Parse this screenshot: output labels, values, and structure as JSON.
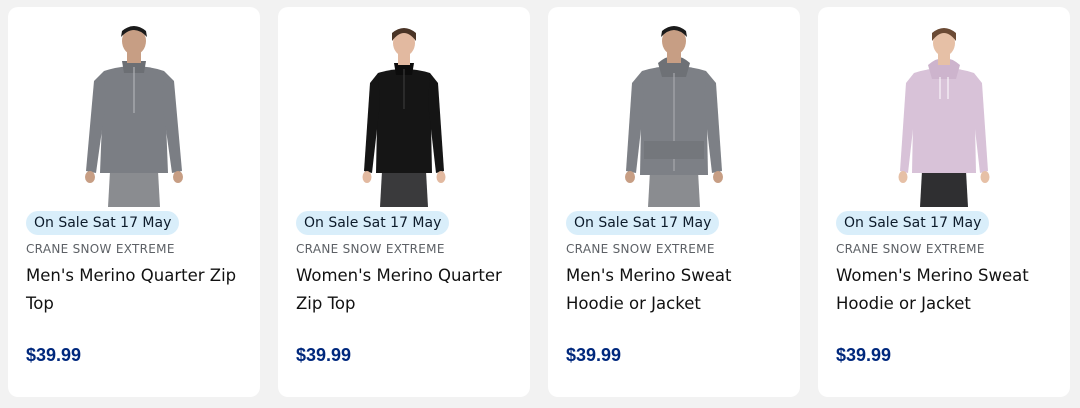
{
  "theme": {
    "badge_bg": "#d9eefa",
    "price_color": "#00287d",
    "card_bg": "#ffffff",
    "page_bg": "#f2f2f2"
  },
  "products": [
    {
      "image": "mens-grey-merino-quarter-zip-model",
      "badge": "On Sale Sat 17 May",
      "brand": "CRANE SNOW EXTREME",
      "title": "Men's Merino Quarter Zip Top",
      "price": "$39.99",
      "garment_color": "#7b7e84"
    },
    {
      "image": "womens-black-merino-quarter-zip-model",
      "badge": "On Sale Sat 17 May",
      "brand": "CRANE SNOW EXTREME",
      "title": "Women's Merino Quarter Zip Top",
      "price": "$39.99",
      "garment_color": "#151515"
    },
    {
      "image": "mens-grey-merino-hoodie-model",
      "badge": "On Sale Sat 17 May",
      "brand": "CRANE SNOW EXTREME",
      "title": "Men's Merino Sweat Hoodie or Jacket",
      "price": "$39.99",
      "garment_color": "#7d8086"
    },
    {
      "image": "womens-lilac-merino-hoodie-model",
      "badge": "On Sale Sat 17 May",
      "brand": "CRANE SNOW EXTREME",
      "title": "Women's Merino Sweat Hoodie or Jacket",
      "price": "$39.99",
      "garment_color": "#d8c2d8"
    }
  ]
}
